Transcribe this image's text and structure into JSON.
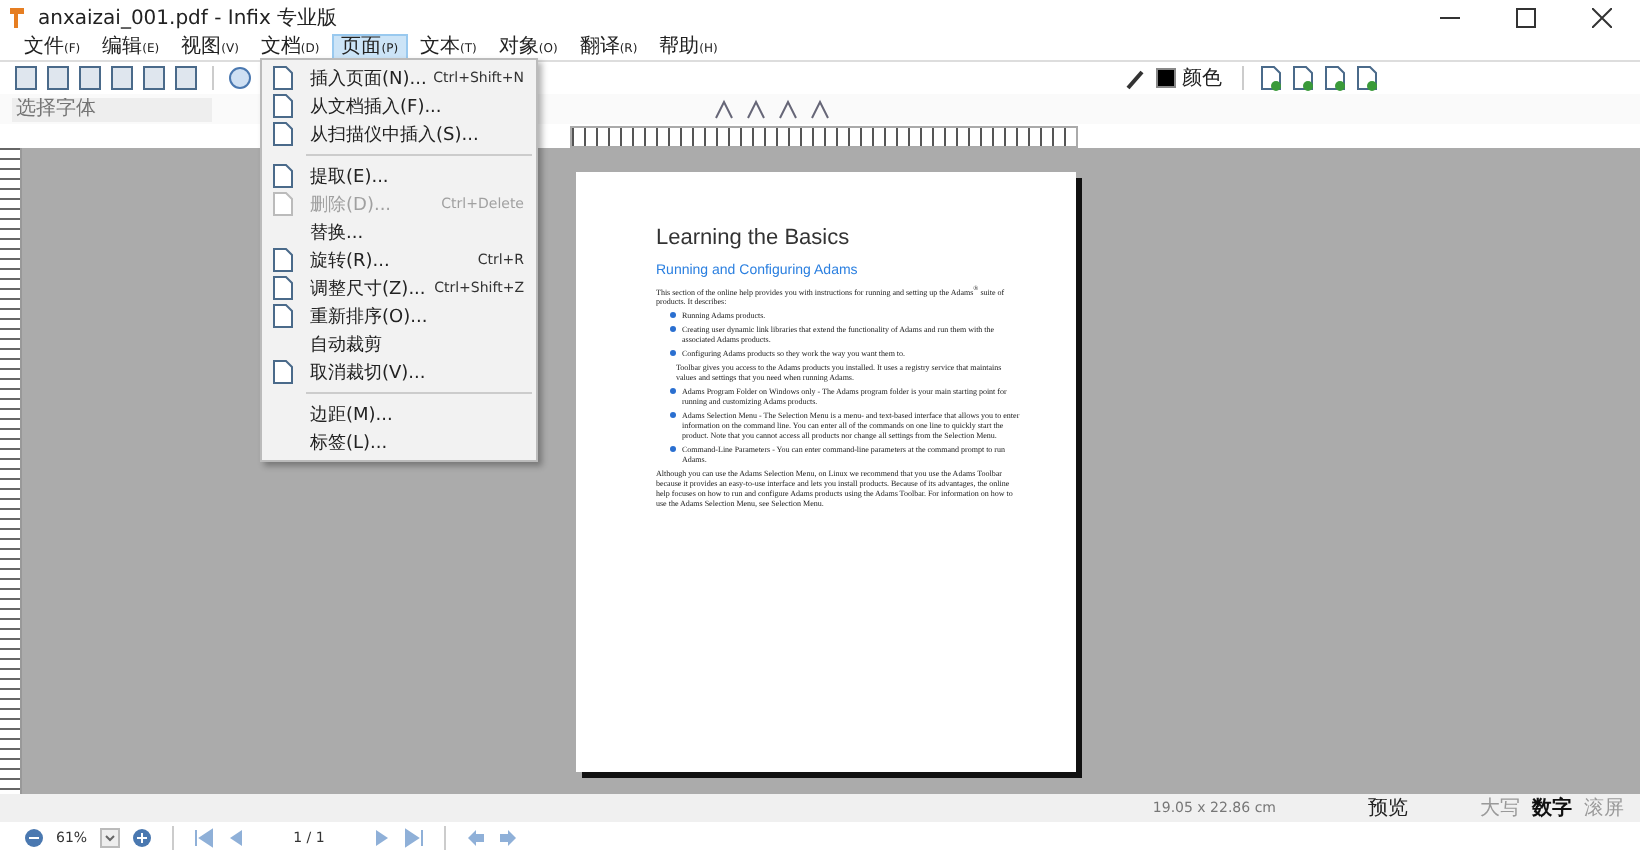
{
  "window": {
    "title": "anxaizai_001.pdf - Infix 专业版"
  },
  "menu_bar": [
    {
      "label": "文件",
      "key": "(F)",
      "selected": false
    },
    {
      "label": "编辑",
      "key": "(E)",
      "selected": false
    },
    {
      "label": "视图",
      "key": "(V)",
      "selected": false
    },
    {
      "label": "文档",
      "key": "(D)",
      "selected": false
    },
    {
      "label": "页面",
      "key": "(P)",
      "selected": true
    },
    {
      "label": "文本",
      "key": "(T)",
      "selected": false
    },
    {
      "label": "对象",
      "key": "(O)",
      "selected": false
    },
    {
      "label": "翻译",
      "key": "(R)",
      "selected": false
    },
    {
      "label": "帮助",
      "key": "(H)",
      "selected": false
    }
  ],
  "toolbar": {
    "color_label": "颜色",
    "font_field": {
      "placeholder": "选择字体"
    }
  },
  "page_menu": [
    {
      "kind": "icon-item",
      "label": "插入页面(N)...",
      "shortcut": "Ctrl+Shift+N",
      "disabled": false
    },
    {
      "kind": "icon-item",
      "label": "从文档插入(F)...",
      "disabled": false
    },
    {
      "kind": "icon-item",
      "label": "从扫描仪中插入(S)...",
      "disabled": false
    },
    {
      "kind": "separator"
    },
    {
      "kind": "icon-item",
      "label": "提取(E)...",
      "disabled": false
    },
    {
      "kind": "icon-item",
      "label": "删除(D)...",
      "shortcut": "Ctrl+Delete",
      "disabled": true
    },
    {
      "kind": "text-item",
      "label": "替换...",
      "disabled": false
    },
    {
      "kind": "icon-item",
      "label": "旋转(R)...",
      "shortcut": "Ctrl+R",
      "disabled": false
    },
    {
      "kind": "icon-item",
      "label": "调整尺寸(Z)...",
      "shortcut": "Ctrl+Shift+Z",
      "disabled": false
    },
    {
      "kind": "icon-item",
      "label": "重新排序(O)...",
      "disabled": false
    },
    {
      "kind": "text-item",
      "label": "自动裁剪",
      "disabled": false
    },
    {
      "kind": "icon-item",
      "label": "取消裁切(V)...",
      "disabled": false
    },
    {
      "kind": "separator"
    },
    {
      "kind": "text-item",
      "label": "边距(M)...",
      "disabled": false
    },
    {
      "kind": "text-item",
      "label": "标签(L)...",
      "disabled": false
    }
  ],
  "document": {
    "title": "Learning the Basics",
    "heading": "Running and Configuring Adams",
    "blocks": [
      {
        "kind": "para",
        "text": "This section of the online help provides you with instructions for running and setting up the Adams$^{®}$ suite of products. It describes:"
      },
      {
        "kind": "bullet",
        "text": "Running Adams products."
      },
      {
        "kind": "bullet",
        "text": "Creating user dynamic link libraries that extend the functionality of Adams and run them with the associated Adams products."
      },
      {
        "kind": "bullet",
        "text": "Configuring Adams products so they work the way you want them to."
      },
      {
        "kind": "sub",
        "text": "Toolbar gives you access to the Adams products you installed. It uses a registry service that maintains values and settings that you need when running Adams."
      },
      {
        "kind": "bullet",
        "text": "Adams Program Folder on Windows only - The Adams program folder is your main starting point for running and customizing Adams products."
      },
      {
        "kind": "bullet",
        "text": "Adams Selection Menu - The Selection Menu is a menu- and text-based interface that allows you to enter information on the command line. You can enter all of the commands on one line to quickly start the product. Note that you cannot access all products nor change all settings from the Selection Menu."
      },
      {
        "kind": "bullet",
        "text": "Command-Line Parameters - You can enter command-line parameters at the command prompt to run Adams."
      },
      {
        "kind": "para",
        "text": "Although you can use the Adams Selection Menu, on Linux we recommend that you use the Adams Toolbar because it provides an easy-to-use interface and lets you install products. Because of its advantages, the online help focuses on how to run and configure Adams products using the Adams Toolbar. For information on how to use the Adams Selection Menu, see Selection Menu."
      }
    ]
  },
  "status_bar": {
    "page_size": "19.05 x 22.86 cm",
    "mode": "预览",
    "indicators": [
      {
        "label": "大写",
        "on": false
      },
      {
        "label": "数字",
        "on": true
      },
      {
        "label": "滚屏",
        "on": false
      }
    ]
  },
  "navigation": {
    "zoom": "61%",
    "page": "1 / 1"
  }
}
